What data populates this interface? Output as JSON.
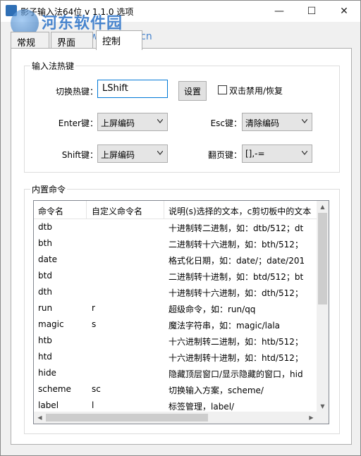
{
  "window": {
    "title": "影子输入法64位 v 1.1.0 选项",
    "minimize": "—",
    "maximize": "☐",
    "close": "✕"
  },
  "watermark": {
    "title": "河东软件园",
    "url": "www.pc0359.cn"
  },
  "tabs": [
    {
      "label": "常规",
      "active": false
    },
    {
      "label": "界面",
      "active": false
    },
    {
      "label": "控制",
      "active": true
    }
  ],
  "hotkey_group": {
    "legend": "输入法热键",
    "switch_label": "切换热键：",
    "switch_value": "LShift",
    "set_button": "设置",
    "dblclick_label": "双击禁用/恢复",
    "enter_label": "Enter键：",
    "enter_value": "上屏编码",
    "esc_label": "Esc键：",
    "esc_value": "清除编码",
    "shift_label": "Shift键：",
    "shift_value": "上屏编码",
    "page_label": "翻页键：",
    "page_value": "[],-="
  },
  "commands_group": {
    "legend": "内置命令",
    "columns": [
      "命令名",
      "自定义命令名",
      "说明(s)选择的文本，c剪切板中的文本"
    ],
    "rows": [
      {
        "name": "dtb",
        "custom": "",
        "desc": "十进制转二进制，如：dtb/512；dt"
      },
      {
        "name": "bth",
        "custom": "",
        "desc": "二进制转十六进制，如：bth/512；"
      },
      {
        "name": "date",
        "custom": "",
        "desc": "格式化日期，如：date/；date/201"
      },
      {
        "name": "btd",
        "custom": "",
        "desc": "二进制转十进制，如：btd/512；bt"
      },
      {
        "name": "dth",
        "custom": "",
        "desc": "十进制转十六进制，如：dth/512；"
      },
      {
        "name": "run",
        "custom": "r",
        "desc": "超级命令，如：run/qq"
      },
      {
        "name": "magic",
        "custom": "s",
        "desc": "魔法字符串，如：magic/lala"
      },
      {
        "name": "htb",
        "custom": "",
        "desc": "十六进制转二进制，如：htb/512；"
      },
      {
        "name": "htd",
        "custom": "",
        "desc": "十六进制转十进制，如：htd/512；"
      },
      {
        "name": "hide",
        "custom": "",
        "desc": "隐藏顶层窗口/显示隐藏的窗口，hid"
      },
      {
        "name": "scheme",
        "custom": "sc",
        "desc": "切换输入方案，scheme/"
      },
      {
        "name": "label",
        "custom": "l",
        "desc": "标签管理，label/"
      }
    ]
  }
}
